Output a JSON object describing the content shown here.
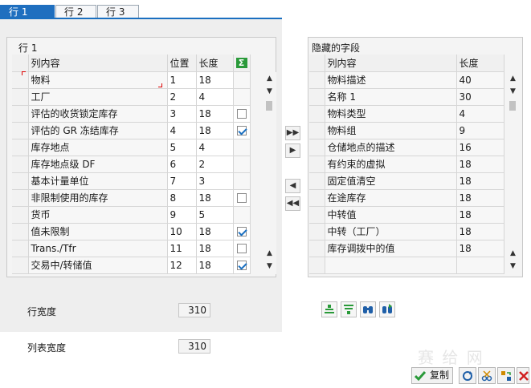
{
  "tabs": [
    {
      "label": "行 1"
    },
    {
      "label": "行 2"
    },
    {
      "label": "行 3"
    }
  ],
  "left_group": {
    "title": "行 1",
    "columns": {
      "content": "列内容",
      "position": "位置",
      "length": "长度"
    },
    "rows": [
      {
        "content": "物料",
        "position": "1",
        "length": "18",
        "checkbox": "none"
      },
      {
        "content": "工厂",
        "position": "2",
        "length": "4",
        "checkbox": "none"
      },
      {
        "content": "评估的收货锁定库存",
        "position": "3",
        "length": "18",
        "checkbox": "off"
      },
      {
        "content": "评估的 GR 冻结库存",
        "position": "4",
        "length": "18",
        "checkbox": "on"
      },
      {
        "content": "库存地点",
        "position": "5",
        "length": "4",
        "checkbox": "none"
      },
      {
        "content": "库存地点级 DF",
        "position": "6",
        "length": "2",
        "checkbox": "none"
      },
      {
        "content": "基本计量单位",
        "position": "7",
        "length": "3",
        "checkbox": "none"
      },
      {
        "content": "非限制使用的库存",
        "position": "8",
        "length": "18",
        "checkbox": "off"
      },
      {
        "content": "货币",
        "position": "9",
        "length": "5",
        "checkbox": "none"
      },
      {
        "content": "值未限制",
        "position": "10",
        "length": "18",
        "checkbox": "on"
      },
      {
        "content": "Trans./Tfr",
        "position": "11",
        "length": "18",
        "checkbox": "off"
      },
      {
        "content": "交易中/转储值",
        "position": "12",
        "length": "18",
        "checkbox": "on"
      }
    ]
  },
  "right_group": {
    "title": "隐藏的字段",
    "columns": {
      "content": "列内容",
      "length": "长度"
    },
    "rows": [
      {
        "content": "物料描述",
        "length": "40"
      },
      {
        "content": "名称 1",
        "length": "30"
      },
      {
        "content": "物料类型",
        "length": "4"
      },
      {
        "content": "物料组",
        "length": "9"
      },
      {
        "content": "仓储地点的描述",
        "length": "16"
      },
      {
        "content": "有约束的虚拟",
        "length": "18"
      },
      {
        "content": "固定值清空",
        "length": "18"
      },
      {
        "content": "在途库存",
        "length": "18"
      },
      {
        "content": "中转值",
        "length": "18"
      },
      {
        "content": "中转（工厂）",
        "length": "18"
      },
      {
        "content": "库存调拨中的值",
        "length": "18"
      }
    ]
  },
  "row_width": {
    "label": "行宽度",
    "value": "310"
  },
  "list_width": {
    "label": "列表宽度",
    "value": "310"
  },
  "footer": {
    "copy_label": "复制"
  },
  "watermark": "赛 给 网",
  "colors": {
    "accent": "#1f6fbf",
    "check": "#1a6fc0",
    "sigma": "#2a9a3a",
    "cancel": "#d02020"
  }
}
